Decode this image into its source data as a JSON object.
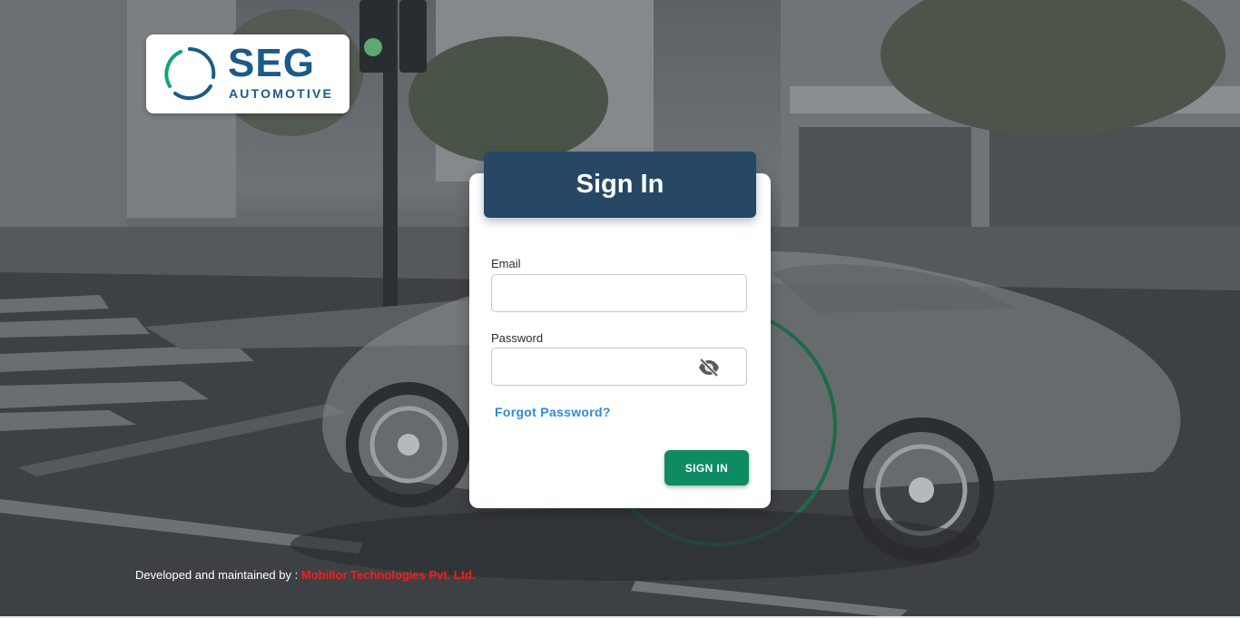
{
  "logo": {
    "brand": "SEG",
    "subtitle": "AUTOMOTIVE"
  },
  "login": {
    "title": "Sign In",
    "email_label": "Email",
    "email_value": "",
    "password_label": "Password",
    "password_value": "",
    "forgot_label": "Forgot Password?",
    "submit_label": "SIGN IN"
  },
  "footer": {
    "prefix": "Developed and maintained by : ",
    "company": "Mobillor Technologies Pvt. Ltd."
  },
  "icons": {
    "password_toggle": "eye-off-icon"
  },
  "colors": {
    "header": "#274864",
    "button": "#0e8b63",
    "link": "#2f8ad6",
    "company": "#ff1a1a",
    "brand": "#1c5a86"
  }
}
